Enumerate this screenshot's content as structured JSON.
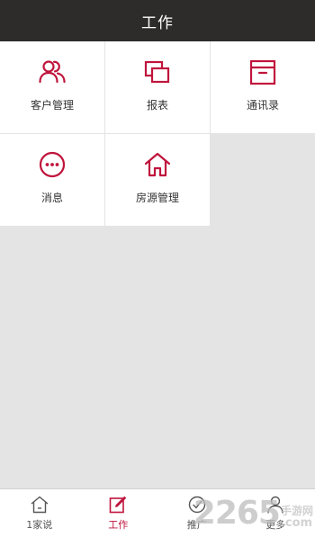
{
  "header": {
    "title": "工作"
  },
  "grid": {
    "items": [
      {
        "label": "客户管理",
        "icon": "customers-icon"
      },
      {
        "label": "报表",
        "icon": "report-icon"
      },
      {
        "label": "通讯录",
        "icon": "contacts-box-icon"
      },
      {
        "label": "消息",
        "icon": "message-icon"
      },
      {
        "label": "房源管理",
        "icon": "house-icon"
      }
    ]
  },
  "tabbar": {
    "items": [
      {
        "label": "1家说",
        "icon": "home-outline-icon",
        "active": false
      },
      {
        "label": "工作",
        "icon": "edit-icon",
        "active": true
      },
      {
        "label": "推广",
        "icon": "promote-icon",
        "active": false
      },
      {
        "label": "更多",
        "icon": "person-icon",
        "active": false
      }
    ]
  },
  "watermark": {
    "number": "2265",
    "top_text": "手游网",
    "bottom_text": ".com"
  },
  "colors": {
    "header_bg": "#2e2b2b",
    "accent": "#c0143c",
    "page_bg": "#e4e4e4",
    "tile_bg": "#ffffff"
  }
}
